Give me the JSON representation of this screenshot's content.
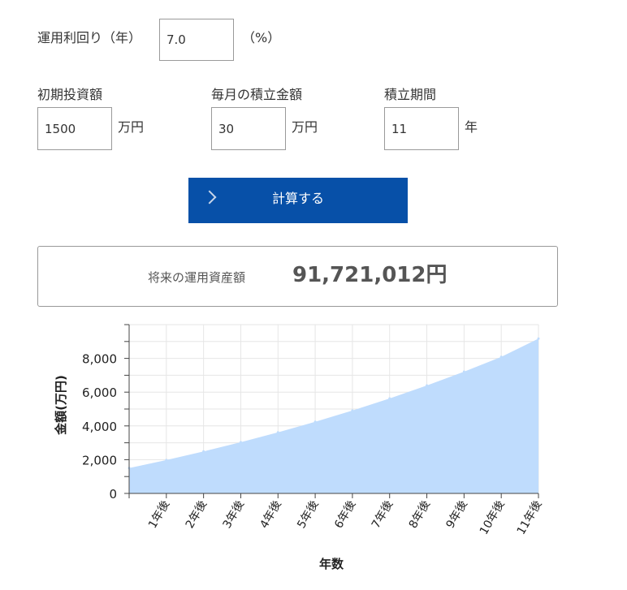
{
  "form": {
    "rate_label": "運用利回り（年）",
    "rate_value": "7.0",
    "rate_unit": "（%）",
    "initial_label": "初期投資額",
    "initial_value": "1500",
    "initial_unit": "万円",
    "monthly_label": "毎月の積立金額",
    "monthly_value": "30",
    "monthly_unit": "万円",
    "period_label": "積立期間",
    "period_value": "11",
    "period_unit": "年"
  },
  "button": {
    "label": "計算する",
    "icon": "chevron-right-icon"
  },
  "result": {
    "label": "将来の運用資産額",
    "value": "91,721,012円"
  },
  "colors": {
    "accent": "#0750a8",
    "area_fill": "#bfdcfd",
    "grid": "#e6e6e6"
  },
  "chart_data": {
    "type": "area",
    "xlabel": "年数",
    "ylabel": "金額(万円)",
    "categories": [
      "",
      "1年後",
      "2年後",
      "3年後",
      "4年後",
      "5年後",
      "6年後",
      "7年後",
      "8年後",
      "9年後",
      "10年後",
      "11年後"
    ],
    "values": [
      1500,
      1977,
      2487,
      3033,
      3617,
      4242,
      4911,
      5627,
      6392,
      7212,
      8089,
      9172
    ],
    "yticks": [
      0,
      2000,
      4000,
      6000,
      8000
    ],
    "ylim": [
      0,
      10000
    ],
    "grid": true,
    "legend": "none"
  }
}
